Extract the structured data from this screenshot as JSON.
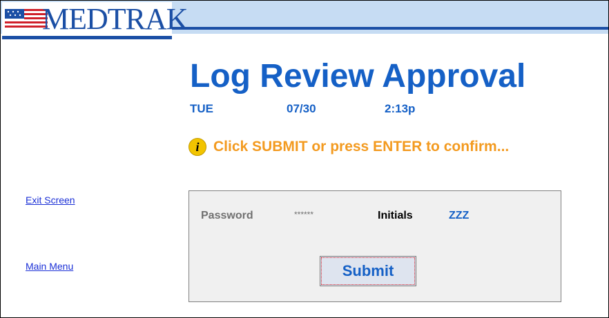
{
  "brand": {
    "logo_text": "MEDTRAK",
    "colors": {
      "header_bg": "#c6dcf3",
      "brand_blue": "#1b4fa5",
      "flag_red": "#d0202a"
    }
  },
  "page": {
    "title": "Log Review Approval",
    "day": "TUE",
    "date": "07/30",
    "time": "2:13p",
    "title_color": "#1560c6"
  },
  "notice": {
    "icon": "info-icon",
    "text": "Click SUBMIT or press ENTER to confirm...",
    "color": "#f39a1f"
  },
  "sidebar": {
    "links": [
      {
        "label": "Exit Screen"
      },
      {
        "label": "Main Menu"
      }
    ]
  },
  "form": {
    "password_label": "Password",
    "password_value": "******",
    "initials_label": "Initials",
    "initials_value": "ZZZ",
    "submit_label": "Submit"
  }
}
